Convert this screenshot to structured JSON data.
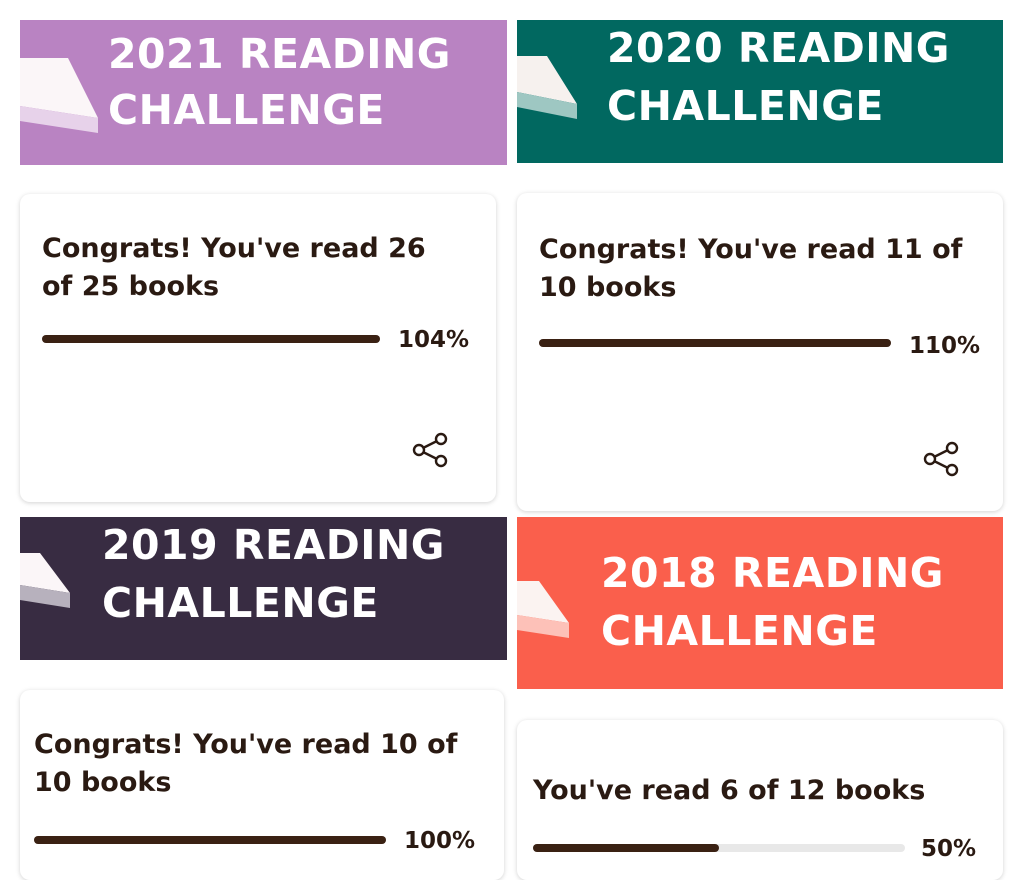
{
  "challenges": [
    {
      "banner_title_line1": "2021 READING",
      "banner_title_line2": "CHALLENGE",
      "banner_color": "#b983c2",
      "message": "Congrats! You've read 26 of 25 books",
      "progress_fraction": 1.0,
      "percent_label": "104%",
      "icons": {
        "book": "book-icon",
        "share": "share-icon"
      }
    },
    {
      "banner_title_line1": "2020 READING",
      "banner_title_line2": "CHALLENGE",
      "banner_color": "#016860",
      "message": "Congrats! You've read 11 of 10 books",
      "progress_fraction": 1.0,
      "percent_label": "110%",
      "icons": {
        "book": "book-icon",
        "share": "share-icon"
      }
    },
    {
      "banner_title_line1": "2019 READING",
      "banner_title_line2": "CHALLENGE",
      "banner_color": "#382c42",
      "message": "Congrats! You've read 10 of 10 books",
      "progress_fraction": 1.0,
      "percent_label": "100%",
      "icons": {
        "book": "book-icon"
      }
    },
    {
      "banner_title_line1": "2018 READING",
      "banner_title_line2": "CHALLENGE",
      "banner_color": "#fa5f4c",
      "message": "You've read 6 of 12 books",
      "progress_fraction": 0.5,
      "percent_label": "50%",
      "icons": {
        "book": "book-icon"
      }
    }
  ],
  "colors": {
    "progress_fill": "#3a2113",
    "progress_track": "#e8e8e8",
    "text": "#2a1a12"
  }
}
